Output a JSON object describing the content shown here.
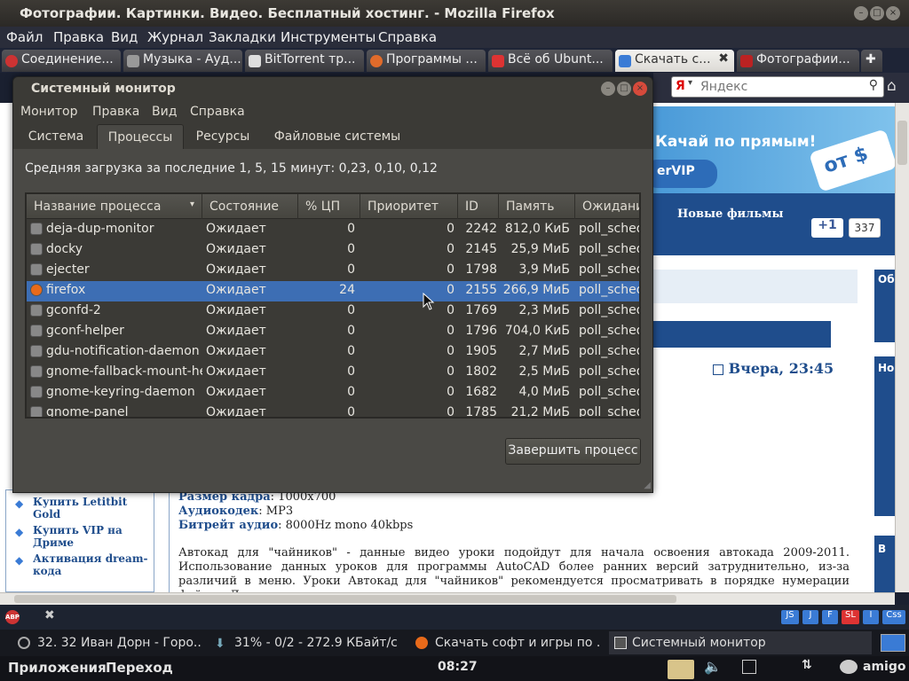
{
  "firefox": {
    "title": "Фотографии. Картинки. Видео. Бесплатный хостинг. - Mozilla Firefox",
    "menu": [
      "Файл",
      "Правка",
      "Вид",
      "Журнал",
      "Закладки",
      "Инструменты",
      "Справка"
    ],
    "tabs": [
      "Соединение...",
      "Музыка - Ауд...",
      "BitTorrent тр...",
      "Программы ...",
      "Всё об Ubunt...",
      "Скачать с...",
      "Фотографии..."
    ],
    "search_placeholder": "Яндекс",
    "google_count": "337",
    "plus_one": "+1"
  },
  "webpage": {
    "banner_text": "Качай по прямым!",
    "banner_button": "erVIP",
    "banner_badge": "от $",
    "nav_link": "Новые фильмы",
    "date": "Вчера, 23:45",
    "side_ob": "Об",
    "side_no": "Но",
    "side_v": "В",
    "sidebar_links": [
      "Купить Letitbit Gold",
      "Купить VIP на Дриме",
      "Активация dream-кода"
    ],
    "frame_size_label": "Размер кадра",
    "frame_size_value": ": 1000x700",
    "audio_codec_label": "Аудиокодек",
    "audio_codec_value": ": MP3",
    "audio_bitrate_label": "Битрейт аудио",
    "audio_bitrate_value": ": 8000Hz mono 40kbps",
    "paragraph": "Автокад для \"чайников\" - данные видео уроки подойдут для начала освоения автокада 2009-2011. Использование данных уроков для программы AutoCAD более ранних версий затруднительно, из-за различий в меню. Уроки Автокад для \"чайников\" рекомендуется просматривать в порядке нумерации файлов. Для просмотра видео уроков"
  },
  "addon_bar": {
    "abp": "ABP",
    "buttons": [
      "JS",
      "J",
      "F",
      "SL",
      "I",
      "Css"
    ]
  },
  "system_monitor": {
    "title": "Системный монитор",
    "menu": [
      "Монитор",
      "Правка",
      "Вид",
      "Справка"
    ],
    "tabs": [
      "Система",
      "Процессы",
      "Ресурсы",
      "Файловые системы"
    ],
    "load_text": "Средняя загрузка за последние 1, 5, 15 минут: 0,23, 0,10, 0,12",
    "columns": [
      "Название процесса",
      "Состояние",
      "% ЦП",
      "Приоритет",
      "ID",
      "Память",
      "Ожидани"
    ],
    "rows": [
      {
        "name": "deja-dup-monitor",
        "state": "Ожидает",
        "cpu": "0",
        "prio": "0",
        "id": "2242",
        "mem": "812,0 КиБ",
        "wait": "poll_sched"
      },
      {
        "name": "docky",
        "state": "Ожидает",
        "cpu": "0",
        "prio": "0",
        "id": "2145",
        "mem": "25,9 МиБ",
        "wait": "poll_sched"
      },
      {
        "name": "ejecter",
        "state": "Ожидает",
        "cpu": "0",
        "prio": "0",
        "id": "1798",
        "mem": "3,9 МиБ",
        "wait": "poll_sched"
      },
      {
        "name": "firefox",
        "state": "Ожидает",
        "cpu": "24",
        "prio": "0",
        "id": "2155",
        "mem": "266,9 МиБ",
        "wait": "poll_sched"
      },
      {
        "name": "gconfd-2",
        "state": "Ожидает",
        "cpu": "0",
        "prio": "0",
        "id": "1769",
        "mem": "2,3 МиБ",
        "wait": "poll_sched"
      },
      {
        "name": "gconf-helper",
        "state": "Ожидает",
        "cpu": "0",
        "prio": "0",
        "id": "1796",
        "mem": "704,0 КиБ",
        "wait": "poll_sched"
      },
      {
        "name": "gdu-notification-daemon",
        "state": "Ожидает",
        "cpu": "0",
        "prio": "0",
        "id": "1905",
        "mem": "2,7 МиБ",
        "wait": "poll_sched"
      },
      {
        "name": "gnome-fallback-mount-hel",
        "state": "Ожидает",
        "cpu": "0",
        "prio": "0",
        "id": "1802",
        "mem": "2,5 МиБ",
        "wait": "poll_sched"
      },
      {
        "name": "gnome-keyring-daemon",
        "state": "Ожидает",
        "cpu": "0",
        "prio": "0",
        "id": "1682",
        "mem": "4,0 МиБ",
        "wait": "poll_sched"
      },
      {
        "name": "gnome-panel",
        "state": "Ожидает",
        "cpu": "0",
        "prio": "0",
        "id": "1785",
        "mem": "21,2 МиБ",
        "wait": "poll_sched"
      }
    ],
    "kill_button": "Завершить процесс"
  },
  "taskbar": {
    "items": [
      "32. 32 Иван Дорн - Горо...",
      "31% - 0/2 - 272.9 КБайт/с ...",
      "Скачать софт и игры по ...",
      "Системный монитор"
    ]
  },
  "panel": {
    "applications": "Приложения",
    "places": "Переход",
    "clock": "08:27",
    "user": "amigo"
  },
  "colors": {
    "selection": "#3d6eb4",
    "window_bg": "#3b3a36"
  }
}
